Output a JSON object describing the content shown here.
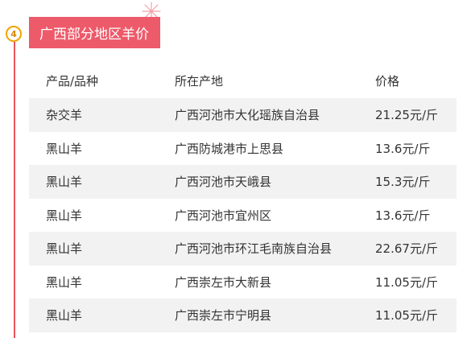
{
  "section": {
    "step_number": "4",
    "title": "广西部分地区羊价"
  },
  "table": {
    "columns": [
      "产品/品种",
      "所在产地",
      "价格"
    ],
    "rows": [
      {
        "product": "杂交羊",
        "origin": "广西河池市大化瑶族自治县",
        "price": "21.25元/斤"
      },
      {
        "product": "黑山羊",
        "origin": "广西防城港市上思县",
        "price": "13.6元/斤"
      },
      {
        "product": "黑山羊",
        "origin": "广西河池市天峨县",
        "price": "15.3元/斤"
      },
      {
        "product": "黑山羊",
        "origin": "广西河池市宜州区",
        "price": "13.6元/斤"
      },
      {
        "product": "黑山羊",
        "origin": "广西河池市环江毛南族自治县",
        "price": "22.67元/斤"
      },
      {
        "product": "黑山羊",
        "origin": "广西崇左市大新县",
        "price": "11.05元/斤"
      },
      {
        "product": "黑山羊",
        "origin": "广西崇左市宁明县",
        "price": "11.05元/斤"
      }
    ]
  },
  "colors": {
    "accent": "#ed5a6a",
    "timeline": "#e8545d",
    "badge_border": "#f0a400",
    "row_shade": "#f2f2f2"
  }
}
